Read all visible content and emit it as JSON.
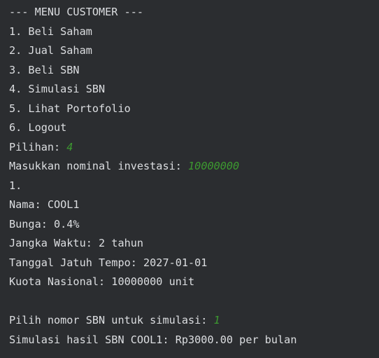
{
  "console": {
    "menu_title": "--- MENU CUSTOMER ---",
    "menu_items": [
      "1. Beli Saham",
      "2. Jual Saham",
      "3. Beli SBN",
      "4. Simulasi SBN",
      "5. Lihat Portofolio",
      "6. Logout"
    ],
    "choice_prompt": "Pilihan: ",
    "choice_input": "4",
    "nominal_prompt": "Masukkan nominal investasi: ",
    "nominal_input": "10000000",
    "sbn_index": "1.",
    "sbn_name": "Nama: COOL1",
    "sbn_interest": "Bunga: 0.4%",
    "sbn_term": "Jangka Waktu: 2 tahun",
    "sbn_maturity": "Tanggal Jatuh Tempo: 2027-01-01",
    "sbn_quota": "Kuota Nasional: 10000000 unit",
    "select_prompt": "Pilih nomor SBN untuk simulasi: ",
    "select_input": "1",
    "result": "Simulasi hasil SBN COOL1: Rp3000.00 per bulan"
  },
  "colors": {
    "background": "#2b2d30",
    "text": "#dcdee1",
    "user_input": "#3d9a30"
  }
}
